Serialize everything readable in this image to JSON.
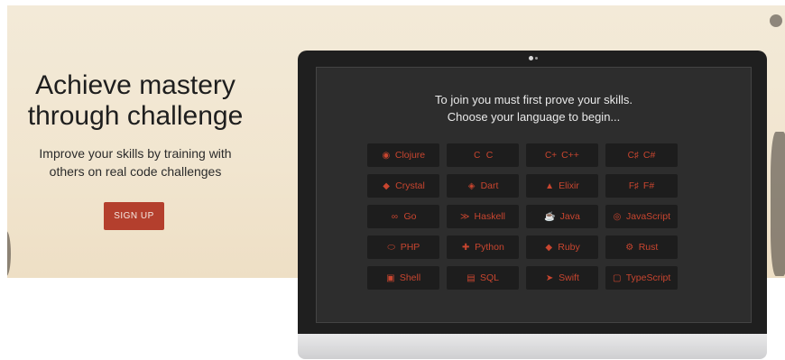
{
  "hero": {
    "title_line1": "Achieve mastery",
    "title_line2": "through challenge",
    "subtitle_line1": "Improve your skills by training with",
    "subtitle_line2": "others on real code challenges",
    "signup_label": "SIGN UP"
  },
  "screen": {
    "prompt_line1": "To join you must first prove your skills.",
    "prompt_line2": "Choose your language to begin...",
    "languages": [
      {
        "label": "Clojure",
        "icon": "clojure-icon",
        "glyph": "◉"
      },
      {
        "label": "C",
        "icon": "c-icon",
        "glyph": "C"
      },
      {
        "label": "C++",
        "icon": "cpp-icon",
        "glyph": "C+"
      },
      {
        "label": "C#",
        "icon": "csharp-icon",
        "glyph": "C♯"
      },
      {
        "label": "Crystal",
        "icon": "crystal-icon",
        "glyph": "◆"
      },
      {
        "label": "Dart",
        "icon": "dart-icon",
        "glyph": "◈"
      },
      {
        "label": "Elixir",
        "icon": "elixir-icon",
        "glyph": "▲"
      },
      {
        "label": "F#",
        "icon": "fsharp-icon",
        "glyph": "F♯"
      },
      {
        "label": "Go",
        "icon": "go-icon",
        "glyph": "∞"
      },
      {
        "label": "Haskell",
        "icon": "haskell-icon",
        "glyph": "≫"
      },
      {
        "label": "Java",
        "icon": "java-icon",
        "glyph": "☕"
      },
      {
        "label": "JavaScript",
        "icon": "javascript-icon",
        "glyph": "◎"
      },
      {
        "label": "PHP",
        "icon": "php-icon",
        "glyph": "⬭"
      },
      {
        "label": "Python",
        "icon": "python-icon",
        "glyph": "✚"
      },
      {
        "label": "Ruby",
        "icon": "ruby-icon",
        "glyph": "◆"
      },
      {
        "label": "Rust",
        "icon": "rust-icon",
        "glyph": "⚙"
      },
      {
        "label": "Shell",
        "icon": "shell-icon",
        "glyph": "▣"
      },
      {
        "label": "SQL",
        "icon": "sql-icon",
        "glyph": "▤"
      },
      {
        "label": "Swift",
        "icon": "swift-icon",
        "glyph": "➤"
      },
      {
        "label": "TypeScript",
        "icon": "typescript-icon",
        "glyph": "▢"
      }
    ]
  },
  "colors": {
    "accent": "#b43f2d",
    "language_text": "#c8452f",
    "screen_bg": "#2d2d2d",
    "hero_bg": "#f1e5cf"
  }
}
